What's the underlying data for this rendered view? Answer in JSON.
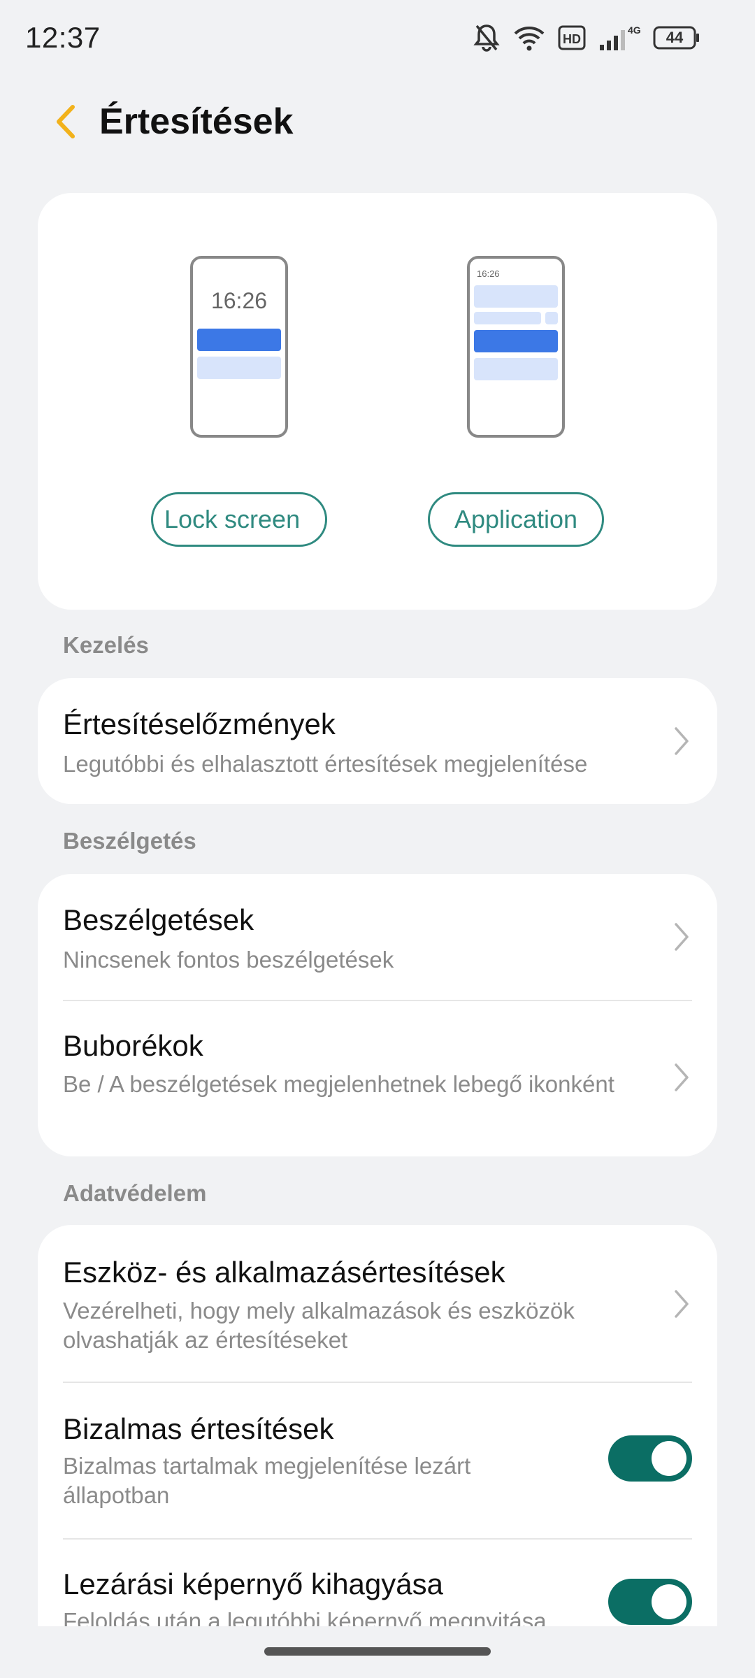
{
  "status_bar": {
    "time": "12:37",
    "battery": "44",
    "network": "4G",
    "hd_label": "HD",
    "icons": [
      "bell-off-icon",
      "wifi-icon",
      "hd-icon",
      "signal-icon",
      "battery-icon"
    ]
  },
  "header": {
    "title": "Értesítések",
    "back_icon": "chevron-left-icon",
    "accent_color": "#f2b21b"
  },
  "preview": {
    "lock_phone_time": "16:26",
    "app_phone_time": "16:26",
    "lock_button": "Lock screen",
    "app_button": "Application",
    "accent_color": "#2f8a80"
  },
  "sections": {
    "manage": {
      "label": "Kezelés",
      "items": [
        {
          "title": "Értesítéselőzmények",
          "subtitle": "Legutóbbi és elhalasztott értesítések megjelenítése"
        }
      ]
    },
    "conversation": {
      "label": "Beszélgetés",
      "items": [
        {
          "title": "Beszélgetések",
          "subtitle": "Nincsenek fontos beszélgetések"
        },
        {
          "title": "Buborékok",
          "subtitle": "Be / A beszélgetések megjelenhetnek lebegő ikonként"
        }
      ]
    },
    "privacy": {
      "label": "Adatvédelem",
      "items": [
        {
          "title": "Eszköz- és alkalmazásértesítések",
          "subtitle": "Vezérelheti, hogy mely alkalmazások és eszközök olvashatják az értesítéseket"
        },
        {
          "title": "Bizalmas értesítések",
          "subtitle": "Bizalmas tartalmak megjelenítése lezárt állapotban",
          "toggle_on": true
        },
        {
          "title": "Lezárási képernyő kihagyása",
          "subtitle": "Feloldás után a legutóbbi képernyő megnyitása",
          "toggle_on": true
        }
      ]
    }
  },
  "toggle_color": "#0b6e64"
}
